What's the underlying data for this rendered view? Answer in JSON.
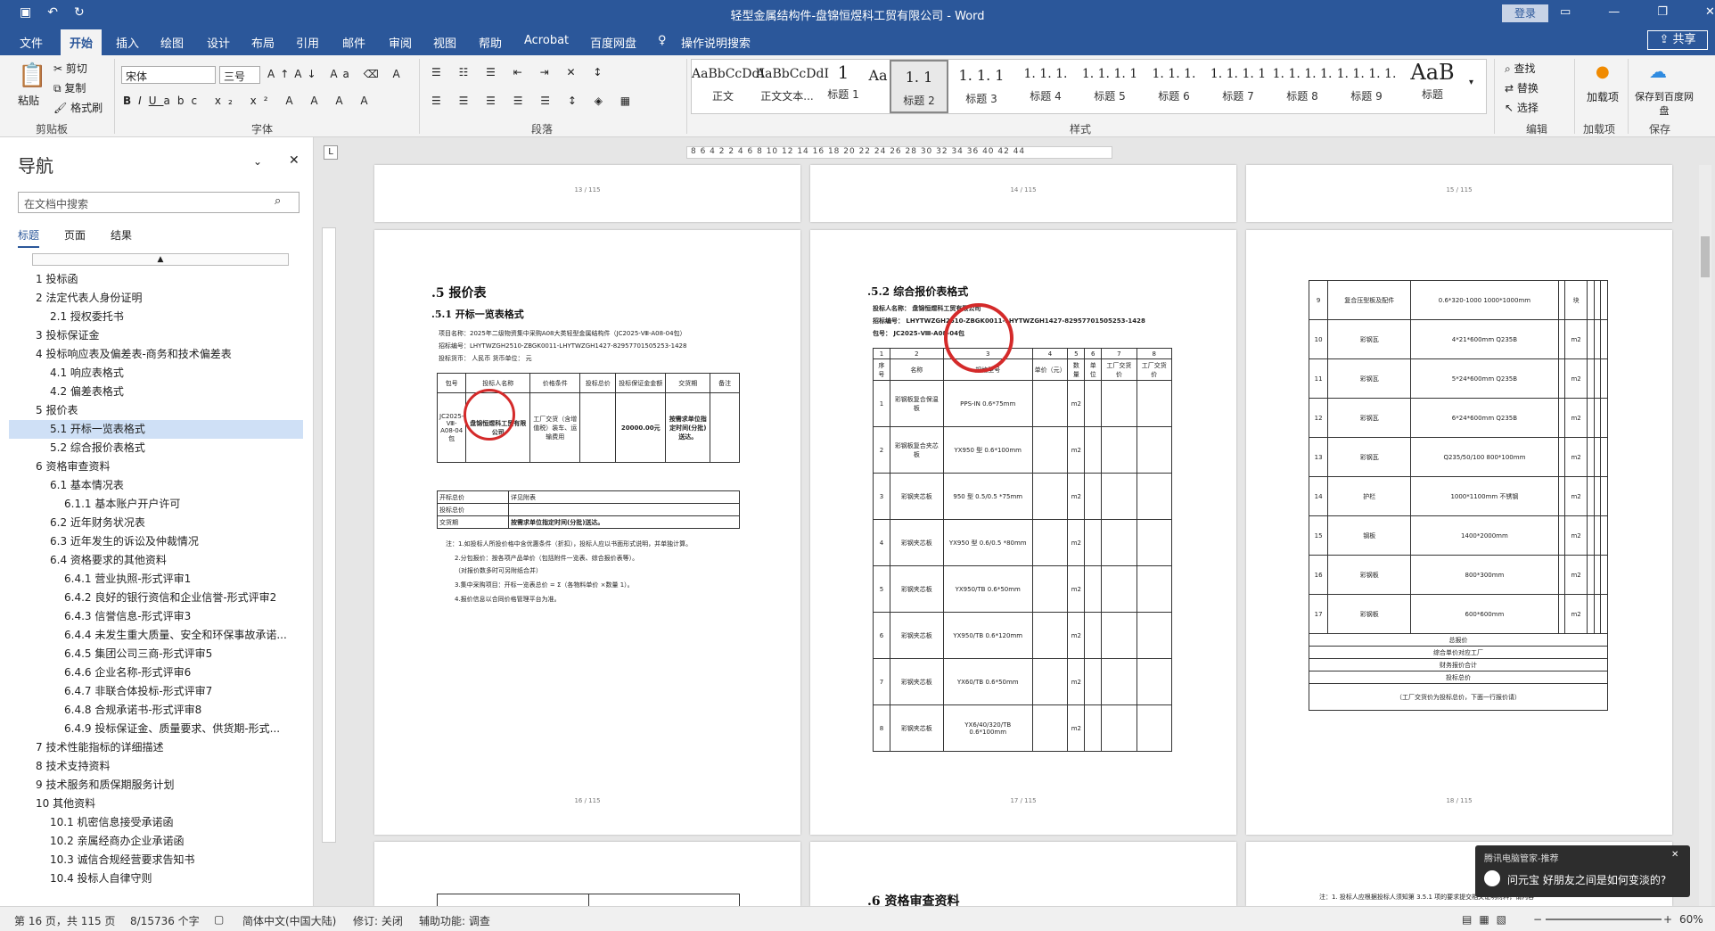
{
  "window": {
    "title": "轻型金属结构件-盘锦恒煜科工贸有限公司 - Word",
    "login_label": "登录"
  },
  "quick_access": {
    "save_icon": "save-icon",
    "undo_icon": "undo-icon",
    "redo_icon": "redo-icon"
  },
  "tabs": [
    {
      "label": "文件"
    },
    {
      "label": "开始"
    },
    {
      "label": "插入"
    },
    {
      "label": "绘图"
    },
    {
      "label": "设计"
    },
    {
      "label": "布局"
    },
    {
      "label": "引用"
    },
    {
      "label": "邮件"
    },
    {
      "label": "审阅"
    },
    {
      "label": "视图"
    },
    {
      "label": "帮助"
    },
    {
      "label": "Acrobat"
    },
    {
      "label": "百度网盘"
    },
    {
      "label": "操作说明搜索"
    }
  ],
  "share_label": "共享",
  "ribbon": {
    "clipboard": {
      "paste": "粘贴",
      "cut": "剪切",
      "copy": "复制",
      "format_painter": "格式刷",
      "group": "剪贴板"
    },
    "font": {
      "name": "宋体",
      "size": "三号",
      "group": "字体"
    },
    "paragraph": {
      "group": "段落"
    },
    "styles": {
      "group": "样式",
      "items": [
        {
          "preview": "AaBbCcDdI",
          "name": "正文"
        },
        {
          "preview": "AaBbCcDdI",
          "name": "正文文本..."
        },
        {
          "preview": "1",
          "name": "标题 1"
        },
        {
          "preview": "Aa",
          "name": "标题"
        },
        {
          "preview": "1. 1",
          "name": "标题 2"
        },
        {
          "preview": "1. 1. 1",
          "name": "标题 3"
        },
        {
          "preview": "1. 1. 1.",
          "name": "标题 4"
        },
        {
          "preview": "1. 1. 1. 1",
          "name": "标题 5"
        },
        {
          "preview": "1. 1. 1.",
          "name": "标题 6"
        },
        {
          "preview": "1. 1. 1. 1",
          "name": "标题 7"
        },
        {
          "preview": "1. 1. 1. 1.",
          "name": "标题 8"
        },
        {
          "preview": "1. 1. 1. 1.",
          "name": "标题 9"
        },
        {
          "preview": "AaB",
          "name": "标题"
        }
      ]
    },
    "editing": {
      "find": "查找",
      "replace": "替换",
      "select": "选择",
      "group": "编辑"
    },
    "addins": {
      "label": "加载项",
      "group": "加载项"
    },
    "save": {
      "label": "保存到百度网盘",
      "group": "保存"
    }
  },
  "nav": {
    "title": "导航",
    "search_placeholder": "在文档中搜索",
    "tabs": [
      "标题",
      "页面",
      "结果"
    ],
    "headings": [
      {
        "text": "1 投标函",
        "level": 1
      },
      {
        "text": "2 法定代表人身份证明",
        "level": 1
      },
      {
        "text": "2.1 授权委托书",
        "level": 2
      },
      {
        "text": "3 投标保证金",
        "level": 1
      },
      {
        "text": "4 投标响应表及偏差表-商务和技术偏差表",
        "level": 1
      },
      {
        "text": "4.1 响应表格式",
        "level": 2
      },
      {
        "text": "4.2 偏差表格式",
        "level": 2
      },
      {
        "text": "5 报价表",
        "level": 1
      },
      {
        "text": "5.1 开标一览表格式",
        "level": 2,
        "selected": true
      },
      {
        "text": "5.2 综合报价表格式",
        "level": 2
      },
      {
        "text": "6 资格审查资料",
        "level": 1
      },
      {
        "text": "6.1 基本情况表",
        "level": 2
      },
      {
        "text": "6.1.1 基本账户开户许可",
        "level": 3
      },
      {
        "text": "6.2 近年财务状况表",
        "level": 2
      },
      {
        "text": "6.3 近年发生的诉讼及仲裁情况",
        "level": 2
      },
      {
        "text": "6.4 资格要求的其他资料",
        "level": 2
      },
      {
        "text": "6.4.1 营业执照-形式评审1",
        "level": 3
      },
      {
        "text": "6.4.2 良好的银行资信和企业信誉-形式评审2",
        "level": 3
      },
      {
        "text": "6.4.3 信誉信息-形式评审3",
        "level": 3
      },
      {
        "text": "6.4.4 未发生重大质量、安全和环保事故承诺...",
        "level": 3
      },
      {
        "text": "6.4.5 集团公司三商-形式评审5",
        "level": 3
      },
      {
        "text": "6.4.6 企业名称-形式评审6",
        "level": 3
      },
      {
        "text": "6.4.7 非联合体投标-形式评审7",
        "level": 3
      },
      {
        "text": "6.4.8 合规承诺书-形式评审8",
        "level": 3
      },
      {
        "text": "6.4.9 投标保证金、质量要求、供货期-形式...",
        "level": 3
      },
      {
        "text": "7 技术性能指标的详细描述",
        "level": 1
      },
      {
        "text": "8 技术支持资料",
        "level": 1
      },
      {
        "text": "9 技术服务和质保期服务计划",
        "level": 1
      },
      {
        "text": "10 其他资料",
        "level": 1
      },
      {
        "text": "10.1 机密信息接受承诺函",
        "level": 2
      },
      {
        "text": "10.2 亲属经商办企业承诺函",
        "level": 2
      },
      {
        "text": "10.3 诚信合规经营要求告知书",
        "level": 2
      },
      {
        "text": "10.4 投标人自律守则",
        "level": 2
      }
    ]
  },
  "ruler": "8 6 4 2 2 4 6 8 10 12 14 16 18 20 22 24 26 28 30 32 34 36 40 42 44",
  "pages": {
    "p13": "13 / 115",
    "p14": "14 / 115",
    "p15": "15 / 115",
    "p16": {
      "num": "16 / 115",
      "h1": ".5  报价表",
      "h2": ".5.1   开标一览表格式",
      "project": "项目名称：2025年二级物资集中采购A08大类轻型金属结构件（JC2025-Ⅷ-A08-04包）",
      "bid_no": "招标编号：LHYTWZGH2510-ZBGK0011-LHYTWZGH1427-82957701505253-1428",
      "currency": "投标货币：     人民币         货币单位：  元",
      "table_head": [
        "包号",
        "投标人名称",
        "价格条件",
        "投标总价",
        "投标保证金金额",
        "交货期",
        "备注"
      ],
      "table_row": [
        "JC2025-Ⅷ-A08-04包",
        "盘锦恒煜科工贸有限公司",
        "工厂交货（含增值税）装车、运输费用",
        "",
        "20000.00元",
        "按需求单位指定时间(分批)送达。",
        ""
      ],
      "row2": [
        [
          "开标总价",
          "详见附表"
        ],
        [
          "投标总价",
          ""
        ],
        [
          "交货期",
          "按需求单位指定时间(分批)送达。"
        ]
      ],
      "notes": [
        "注：1.如投标人所投价格中含优惠条件（折扣），投标人应以书面形式说明，并单独计算。",
        "2.分包报价：按各项产品单价（包括附件一览表、综合报价表等）。",
        "（对报价数多时可另附纸合并）",
        "3.集中采购项目：开标一览表总价 = Σ（各物料单价 ×数量 1）。",
        "4.报价信息以合同价格管理平台为准。"
      ]
    },
    "p17": {
      "num": "17 / 115",
      "h2": ".5.2   综合报价表格式",
      "l1": "投标人名称：  盘锦恒煜科工贸有限公司",
      "l2": "招标编号：  LHYTWZGH2510-ZBGK0011-LHYTWZGH1427-82957701505253-1428",
      "l3": "包号：  JC2025-Ⅷ-A08-04包",
      "head": [
        "序号",
        "名称",
        "规格型号",
        "单价（元）",
        "数量",
        "单位",
        "工厂交货价",
        "工厂交货价"
      ],
      "rows": [
        [
          "1",
          "彩钢板复合保温板",
          "PPS-IN 0.6*75mm",
          "",
          "m2",
          "",
          "",
          ""
        ],
        [
          "2",
          "彩钢板复合夹芯板",
          "YX950 型 0.6*100mm",
          "",
          "m2",
          "",
          "",
          ""
        ],
        [
          "3",
          "彩钢夹芯板",
          "950 型 0.5/0.5 *75mm",
          "",
          "m2",
          "",
          "",
          ""
        ],
        [
          "4",
          "彩钢夹芯板",
          "YX950 型 0.6/0.5 *80mm",
          "",
          "m2",
          "",
          "",
          ""
        ],
        [
          "5",
          "彩钢夹芯板",
          "YX950/TB 0.6*50mm",
          "",
          "m2",
          "",
          "",
          ""
        ],
        [
          "6",
          "彩钢夹芯板",
          "YX950/TB 0.6*120mm",
          "",
          "m2",
          "",
          "",
          ""
        ],
        [
          "7",
          "彩钢夹芯板",
          "YX60/TB 0.6*50mm",
          "",
          "m2",
          "",
          "",
          ""
        ],
        [
          "8",
          "彩钢夹芯板",
          "YX6/40/320/TB 0.6*100mm",
          "",
          "m2",
          "",
          "",
          ""
        ]
      ]
    },
    "p18": {
      "num": "18 / 115",
      "rows": [
        [
          "9",
          "复合压型板及配件",
          "0.6*320-1000 1000*1000mm",
          "",
          "块",
          "",
          "",
          ""
        ],
        [
          "10",
          "彩钢瓦",
          "4*21*600mm Q235B",
          "",
          "m2",
          "",
          "",
          ""
        ],
        [
          "11",
          "彩钢瓦",
          "5*24*600mm Q235B",
          "",
          "m2",
          "",
          "",
          ""
        ],
        [
          "12",
          "彩钢瓦",
          "6*24*600mm Q235B",
          "",
          "m2",
          "",
          "",
          ""
        ],
        [
          "13",
          "彩钢瓦",
          "Q235/50/100 800*100mm",
          "",
          "m2",
          "",
          "",
          ""
        ],
        [
          "14",
          "护栏",
          "1000*1100mm 不锈钢",
          "",
          "m2",
          "",
          "",
          ""
        ],
        [
          "15",
          "钢板",
          "1400*2000mm",
          "",
          "m2",
          "",
          "",
          ""
        ],
        [
          "16",
          "彩钢板",
          "800*300mm",
          "",
          "m2",
          "",
          "",
          ""
        ],
        [
          "17",
          "彩钢板",
          "600*600mm",
          "",
          "m2",
          "",
          "",
          ""
        ]
      ],
      "foot": [
        "总报价",
        "综合单价对应工厂",
        "财务报价合计",
        "投标总价",
        "（工厂交货价为投标总价，下面一行报价请）"
      ]
    },
    "p19_h": ".6  资格审查资料",
    "p19_note": "注：1. 投标人应根据投标人须知第 3.5.1 项的要求提交相关证明材料，请内容"
  },
  "statusbar": {
    "page": "第 16 页，共 115 页",
    "words": "8/15736 个字",
    "lang": "简体中文(中国大陆)",
    "track": "修订: 关闭",
    "access": "辅助功能: 调查",
    "zoom": "60%"
  },
  "popup": {
    "title": "腾讯电脑管家-推荐",
    "text": "问元宝   好朋友之间是如何变淡的?"
  }
}
